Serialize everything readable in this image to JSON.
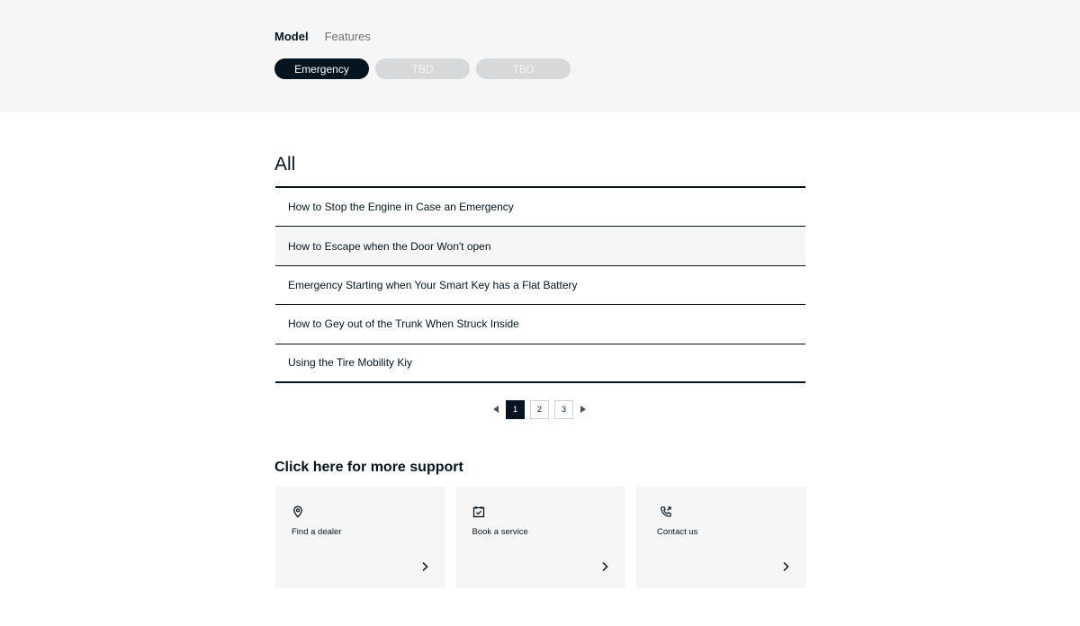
{
  "tabs": {
    "model": "Model",
    "features": "Features"
  },
  "categories": [
    {
      "label": "Emergency",
      "state": "active"
    },
    {
      "label": "TBD",
      "state": "disabled"
    },
    {
      "label": "TBD",
      "state": "disabled"
    }
  ],
  "section_title": "All",
  "faq_items": [
    "How to Stop the Engine in Case an Emergency",
    "How to Escape when the Door Won't open",
    "Emergency Starting when Your Smart Key has a Flat Battery",
    "How to Gey out of the Trunk When Struck Inside",
    "Using the Tire Mobility Kiy"
  ],
  "pagination": {
    "pages": [
      "1",
      "2",
      "3"
    ],
    "current": "1"
  },
  "support": {
    "title": "Click here for more support",
    "cards": [
      {
        "label": "Find a dealer",
        "icon": "location-pin-icon"
      },
      {
        "label": "Book a service",
        "icon": "calendar-check-icon"
      },
      {
        "label": "Contact us",
        "icon": "phone-icon"
      }
    ]
  },
  "colors": {
    "primary": "#05141f",
    "band": "#f6f6f6",
    "pill_disabled": "#d7d8d9"
  }
}
